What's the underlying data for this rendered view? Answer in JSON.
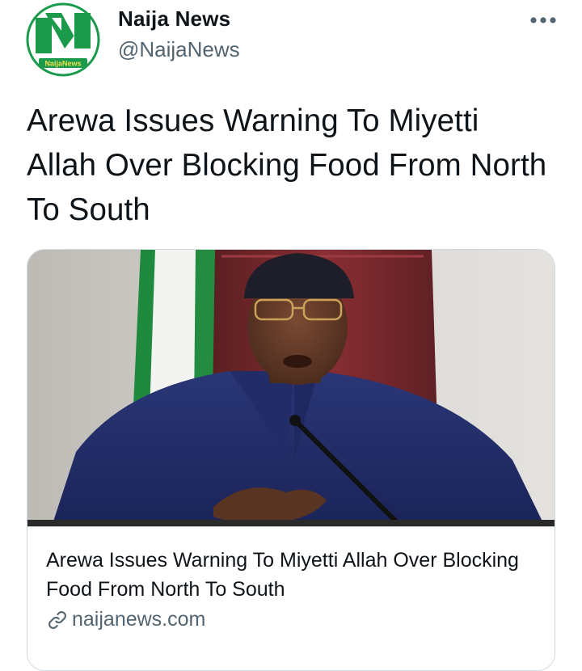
{
  "tweet": {
    "author": {
      "name": "Naija News",
      "handle": "@NaijaNews",
      "avatar_text": "NaijaNews",
      "avatar_icon": "naija-news-logo"
    },
    "more_icon": "more-horizontal-icon",
    "text": "Arewa Issues Warning To Miyetti Allah Over Blocking Food From North To South",
    "card": {
      "image_alt": "Man in dark blue agbada and cap speaking at a microphone in front of a red chair and green-white flag",
      "title": "Arewa Issues Warning To Miyetti Allah Over Blocking Food From North To South",
      "domain": "naijanews.com",
      "link_icon": "link-icon"
    }
  },
  "colors": {
    "text_primary": "#0f1419",
    "text_secondary": "#536471",
    "border": "#cfd9de",
    "logo_green": "#1a9a4a"
  }
}
